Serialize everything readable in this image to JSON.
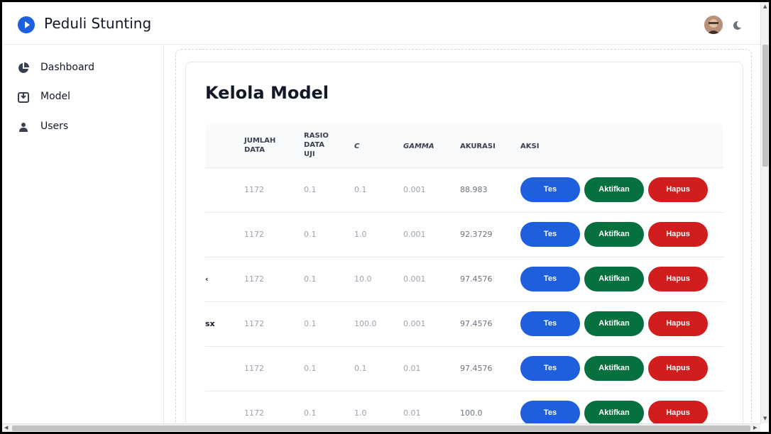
{
  "header": {
    "app_title": "Peduli Stunting",
    "logo_icon": "play-circle-icon",
    "theme_toggle_icon": "moon-icon"
  },
  "sidebar": {
    "items": [
      {
        "label": "Dashboard",
        "icon": "pie-chart-icon"
      },
      {
        "label": "Model",
        "icon": "inbox-download-icon"
      },
      {
        "label": "Users",
        "icon": "user-icon"
      }
    ]
  },
  "main": {
    "title": "Kelola Model",
    "table": {
      "headers": {
        "jumlah_data": [
          "JUMLAH",
          "DATA"
        ],
        "rasio": [
          "RASIO",
          "DATA",
          "UJI"
        ],
        "c": "C",
        "gamma": "GAMMA",
        "akurasi": "AKURASI",
        "aksi": "AKSI"
      },
      "rows": [
        {
          "name": "",
          "jumlah": "1172",
          "rasio": "0.1",
          "c": "0.1",
          "gamma": "0.001",
          "akurasi": "88.983"
        },
        {
          "name": "",
          "jumlah": "1172",
          "rasio": "0.1",
          "c": "1.0",
          "gamma": "0.001",
          "akurasi": "92.3729"
        },
        {
          "name": "‹",
          "jumlah": "1172",
          "rasio": "0.1",
          "c": "10.0",
          "gamma": "0.001",
          "akurasi": "97.4576"
        },
        {
          "name": "sx",
          "jumlah": "1172",
          "rasio": "0.1",
          "c": "100.0",
          "gamma": "0.001",
          "akurasi": "97.4576"
        },
        {
          "name": "",
          "jumlah": "1172",
          "rasio": "0.1",
          "c": "0.1",
          "gamma": "0.01",
          "akurasi": "97.4576"
        },
        {
          "name": "",
          "jumlah": "1172",
          "rasio": "0.1",
          "c": "1.0",
          "gamma": "0.01",
          "akurasi": "100.0"
        }
      ],
      "actions": {
        "test": "Tes",
        "activate": "Aktifkan",
        "delete": "Hapus"
      }
    }
  },
  "colors": {
    "primary": "#1d5fdc",
    "success": "#06703f",
    "danger": "#d11d1d"
  }
}
